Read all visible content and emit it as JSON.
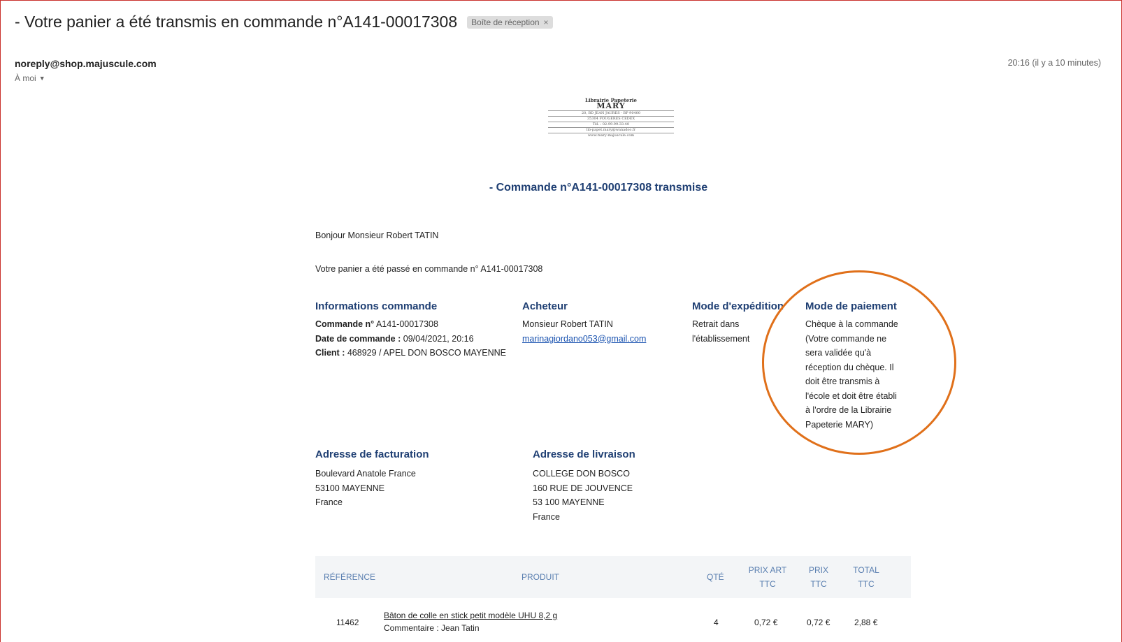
{
  "email": {
    "subject": "- Votre panier a été transmis en commande n°A141-00017308",
    "label_chip": "Boîte de réception",
    "chip_close": "×",
    "sender": "noreply@shop.majuscule.com",
    "recipient": "À moi",
    "time": "20:16 (il y a 10 minutes)"
  },
  "logo": {
    "line1": "Librairie Papeterie",
    "line2": "MARY",
    "addr1": "20, BD JEAN JAURES - BP 90400",
    "addr2": "35304 FOUGERES CEDEX",
    "addr3": "Tél. : 02.99.99.33.40",
    "addr4": "lib-papet.mary@wanadoo.fr",
    "addr5": "www.mary-majuscule.com"
  },
  "order": {
    "title": "- Commande n°A141-00017308 transmise",
    "greeting": "Bonjour Monsieur Robert TATIN",
    "intro": "Votre panier a été passé en commande n° A141-00017308"
  },
  "info": {
    "heading": "Informations commande",
    "order_no_label": "Commande n°",
    "order_no": " A141-00017308",
    "date_label": "Date de commande :",
    "date": " 09/04/2021, 20:16",
    "client_label": "Client :",
    "client": " 468929 / APEL DON BOSCO MAYENNE"
  },
  "buyer": {
    "heading": "Acheteur",
    "name": "Monsieur Robert TATIN",
    "email": "marinagiordano053@gmail.com"
  },
  "shipping": {
    "heading": "Mode d'expédition",
    "line1": "Retrait dans",
    "line2": "l'établissement"
  },
  "payment": {
    "heading": "Mode de paiement",
    "lines": [
      "Chèque à la commande",
      " (Votre commande ne",
      "sera validée qu'à",
      "réception du chèque. Il",
      "doit être transmis à",
      "l'école et doit être établi",
      "à l'ordre de la Librairie",
      "Papeterie MARY)"
    ]
  },
  "billing": {
    "heading": "Adresse de facturation",
    "lines": [
      "Boulevard Anatole France",
      "53100  MAYENNE",
      "France"
    ]
  },
  "delivery": {
    "heading": "Adresse de livraison",
    "lines": [
      "COLLEGE DON BOSCO",
      "160 RUE DE JOUVENCE",
      "53 100  MAYENNE",
      "France"
    ]
  },
  "table": {
    "headers": {
      "ref": "RÉFÉRENCE",
      "product": "PRODUIT",
      "qty": "QTÉ",
      "unit_l1": "PRIX ART",
      "unit_l2": "TTC",
      "price_l1": "PRIX",
      "price_l2": "TTC",
      "total_l1": "TOTAL",
      "total_l2": "TTC"
    },
    "rows": [
      {
        "ref": "11462",
        "product": "Bâton de colle en stick petit modèle UHU 8,2 g",
        "comment": "Commentaire : Jean Tatin",
        "qty": "4",
        "unit": "0,72 €",
        "price": "0,72 €",
        "total": "2,88 €"
      }
    ]
  },
  "colors": {
    "heading_blue": "#1f3f73",
    "table_header_blue": "#5a7fb0",
    "link_blue": "#1a53b0",
    "annotation_orange": "#e0701a",
    "frame_red": "#c9302c"
  }
}
